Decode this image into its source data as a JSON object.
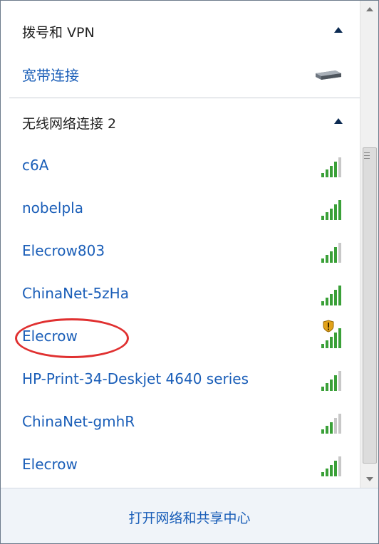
{
  "sections": {
    "dialup": {
      "title": "拨号和 VPN"
    },
    "wireless": {
      "title": "无线网络连接 2"
    }
  },
  "dialup_items": [
    {
      "name": "宽带连接"
    }
  ],
  "networks": [
    {
      "name": "c6A",
      "signal": 4,
      "secured_warning": false
    },
    {
      "name": "nobelpla",
      "signal": 5,
      "secured_warning": false
    },
    {
      "name": "Elecrow803",
      "signal": 4,
      "secured_warning": false
    },
    {
      "name": "ChinaNet-5zHa",
      "signal": 5,
      "secured_warning": false
    },
    {
      "name": "Elecrow",
      "signal": 5,
      "secured_warning": true
    },
    {
      "name": "HP-Print-34-Deskjet 4640 series",
      "signal": 4,
      "secured_warning": false
    },
    {
      "name": "ChinaNet-gmhR",
      "signal": 3,
      "secured_warning": false
    },
    {
      "name": "Elecrow",
      "signal": 4,
      "secured_warning": false
    }
  ],
  "footer": {
    "link": "打开网络和共享中心"
  },
  "colors": {
    "link": "#1a5eb8",
    "signal_on": "#3aa038",
    "signal_off": "#c8c8c8",
    "annotation": "#e03030"
  }
}
